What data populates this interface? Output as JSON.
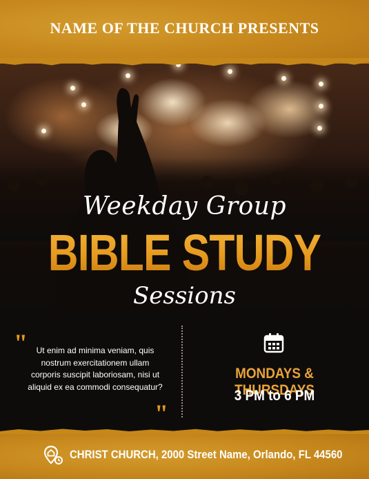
{
  "header": {
    "church_name": "NAME OF THE CHURCH PRESENTS"
  },
  "headline": {
    "line1": "Weekday Group",
    "line2": "BIBLE STUDY",
    "line3": "Sessions"
  },
  "quote": {
    "open_mark": "\"",
    "close_mark": "\"",
    "text": "Ut enim ad minima veniam, quis nostrum exercitationem ullam corporis suscipit laboriosam, nisi ut aliquid ex ea commodi consequatur?"
  },
  "schedule": {
    "icon": "calendar-icon",
    "days": "MONDAYS & THURSDAYS",
    "time": "3 PM to 6 PM"
  },
  "footer": {
    "icon": "location-pin-icon",
    "address": "CHRIST CHURCH, 2000 Street Name, Orlando, FL 44560"
  },
  "colors": {
    "accent_gold": "#e39a22",
    "banner_gold": "#c88a1e",
    "background": "#0e0c0b",
    "text": "#ffffff"
  }
}
